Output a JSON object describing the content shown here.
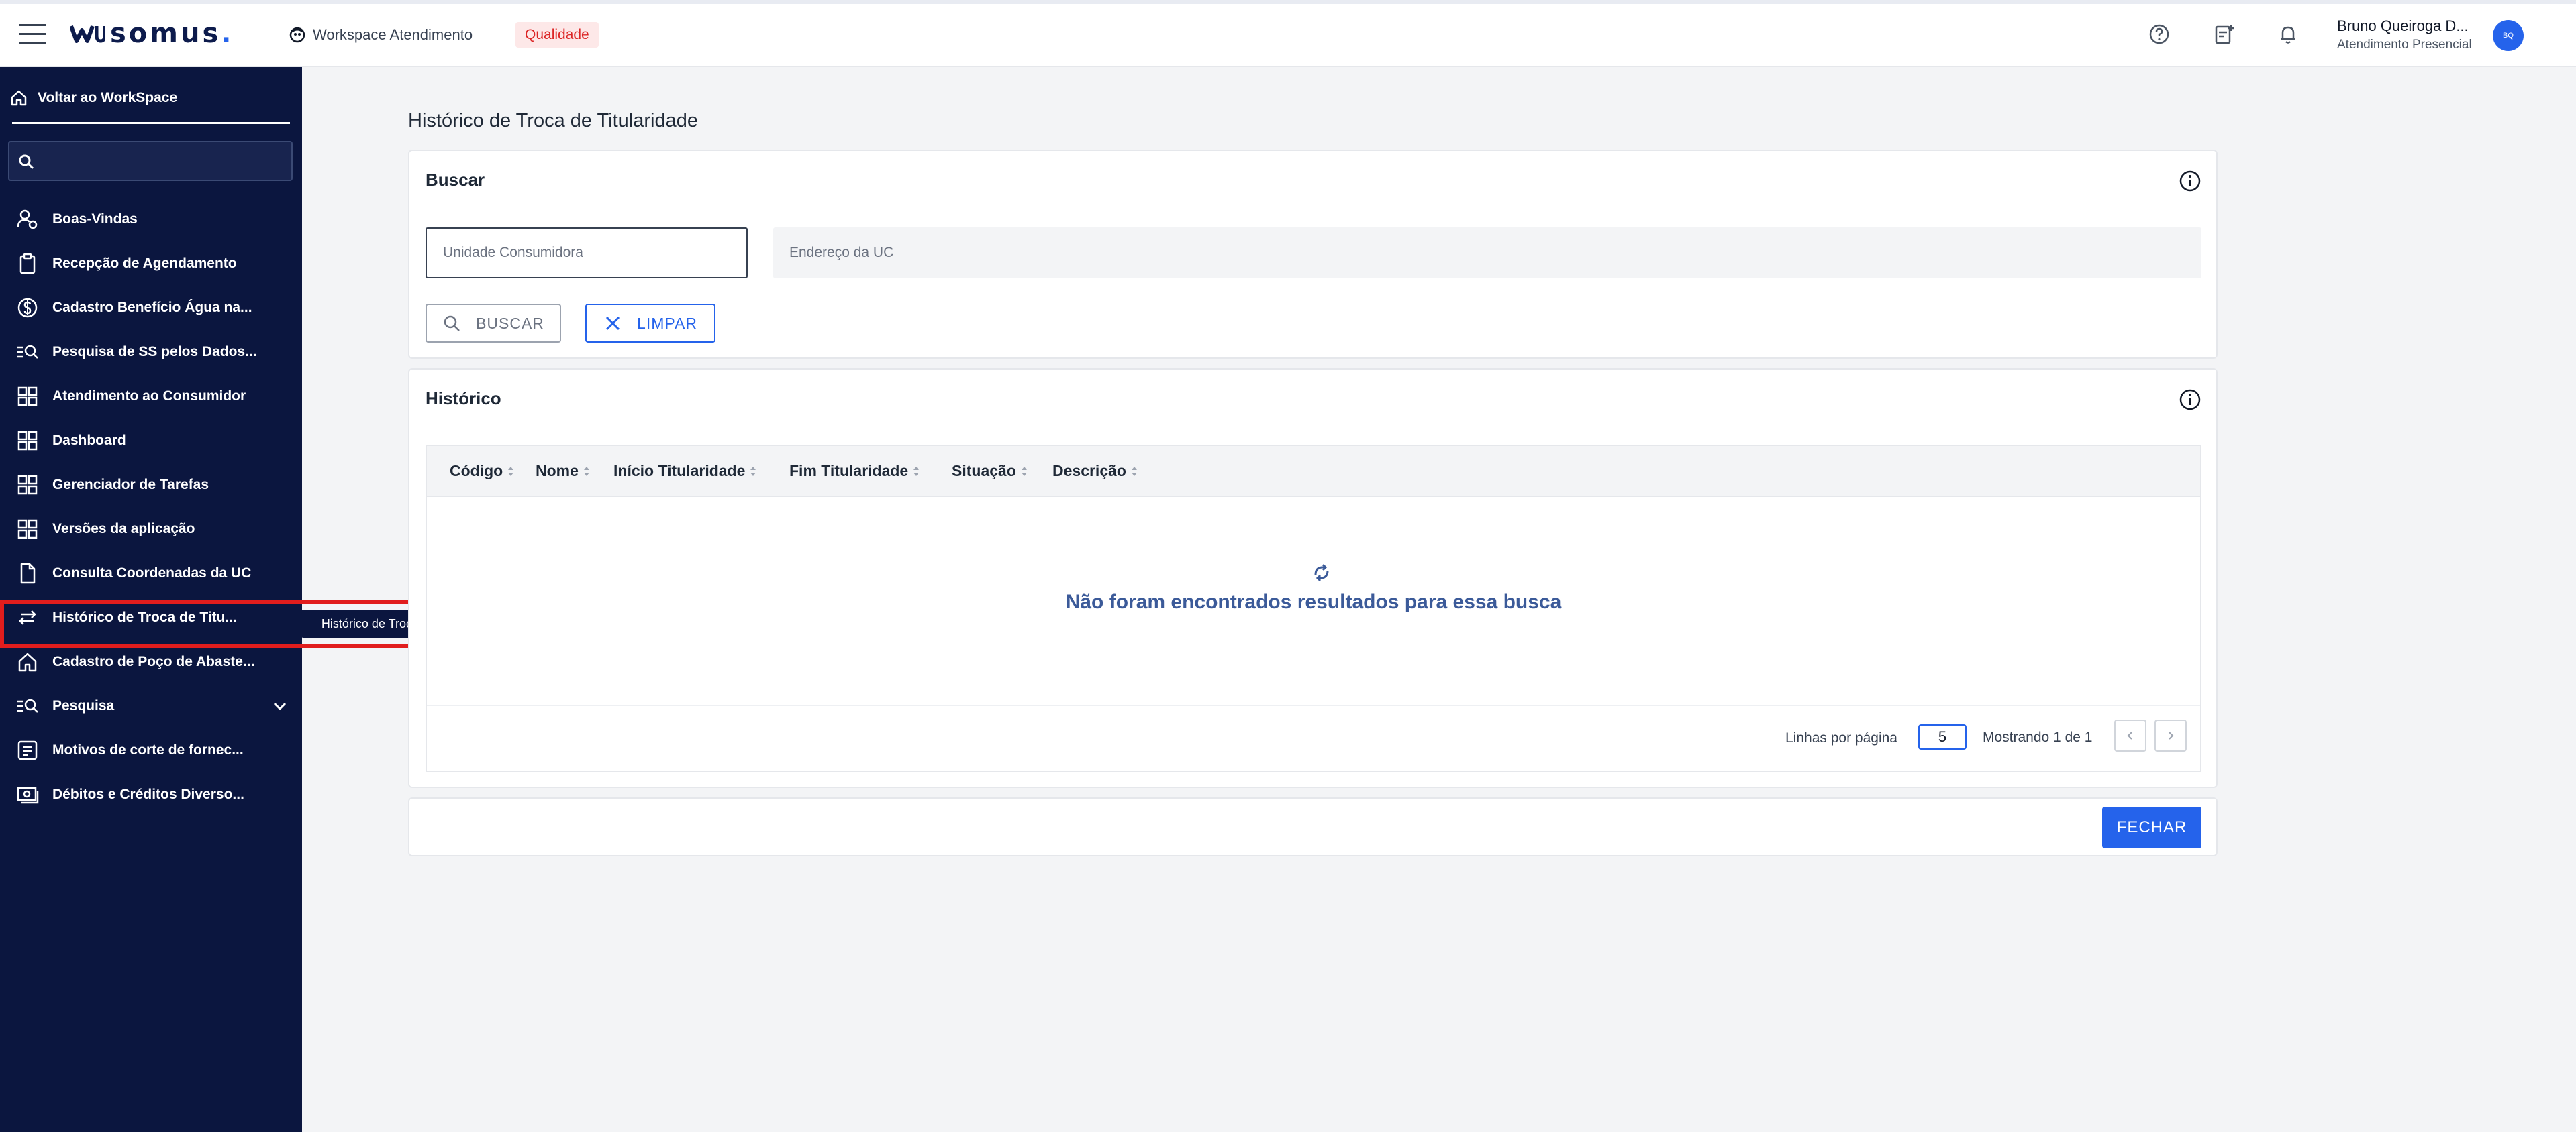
{
  "header": {
    "logo_text": "somus",
    "logo_dot": ".",
    "workspace_label": "Workspace Atendimento",
    "badge_label": "Qualidade",
    "user_name": "Bruno Queiroga D...",
    "user_role": "Atendimento Presencial",
    "avatar_initials": "BQ",
    "icons": [
      "menu-icon",
      "workspace-icon",
      "help-icon",
      "notes-icon",
      "bell-icon"
    ]
  },
  "sidebar": {
    "back_label": "Voltar ao WorkSpace",
    "search_placeholder": "",
    "items": [
      {
        "label": "Boas-Vindas",
        "icon": "user-welcome-icon"
      },
      {
        "label": "Recepção de Agendamento",
        "icon": "clipboard-icon"
      },
      {
        "label": "Cadastro Benefício Água na...",
        "icon": "dollar-icon"
      },
      {
        "label": "Pesquisa de SS pelos Dados...",
        "icon": "list-search-icon"
      },
      {
        "label": "Atendimento ao Consumidor",
        "icon": "grid-icon"
      },
      {
        "label": "Dashboard",
        "icon": "grid-icon"
      },
      {
        "label": "Gerenciador de Tarefas",
        "icon": "grid-icon"
      },
      {
        "label": "Versões da aplicação",
        "icon": "grid-icon"
      },
      {
        "label": "Consulta Coordenadas da UC",
        "icon": "document-icon"
      },
      {
        "label": "Histórico de Troca de Titu...",
        "icon": "swap-icon"
      },
      {
        "label": "Cadastro de Poço de Abaste...",
        "icon": "home-icon"
      },
      {
        "label": "Pesquisa",
        "icon": "list-search-icon"
      },
      {
        "label": "Motivos de corte de fornec...",
        "icon": "notes-icon"
      },
      {
        "label": "Débitos e Créditos Diverso...",
        "icon": "money-icon"
      }
    ],
    "tooltip": "Histórico de Troca de Titularidade"
  },
  "main": {
    "page_title": "Histórico de Troca de Titularidade",
    "search_card": {
      "title": "Buscar",
      "uc_placeholder": "Unidade Consumidora",
      "address_placeholder": "Endereço da UC",
      "search_button": "BUSCAR",
      "clear_button": "LIMPAR"
    },
    "history_card": {
      "title": "Histórico",
      "columns": [
        "Código",
        "Nome",
        "Início Titularidade",
        "Fim Titularidade",
        "Situação",
        "Descrição"
      ],
      "empty_message": "Não foram encontrados resultados para essa busca",
      "rows_per_page_label": "Linhas por página",
      "rows_per_page": "5",
      "showing_label": "Mostrando 1 de 1"
    },
    "close_button": "FECHAR"
  },
  "colors": {
    "sidebar_bg": "#0b163f",
    "primary": "#2563eb",
    "highlight": "#e11d1d",
    "badge_bg": "#fde8e8",
    "badge_text": "#dc2626"
  }
}
